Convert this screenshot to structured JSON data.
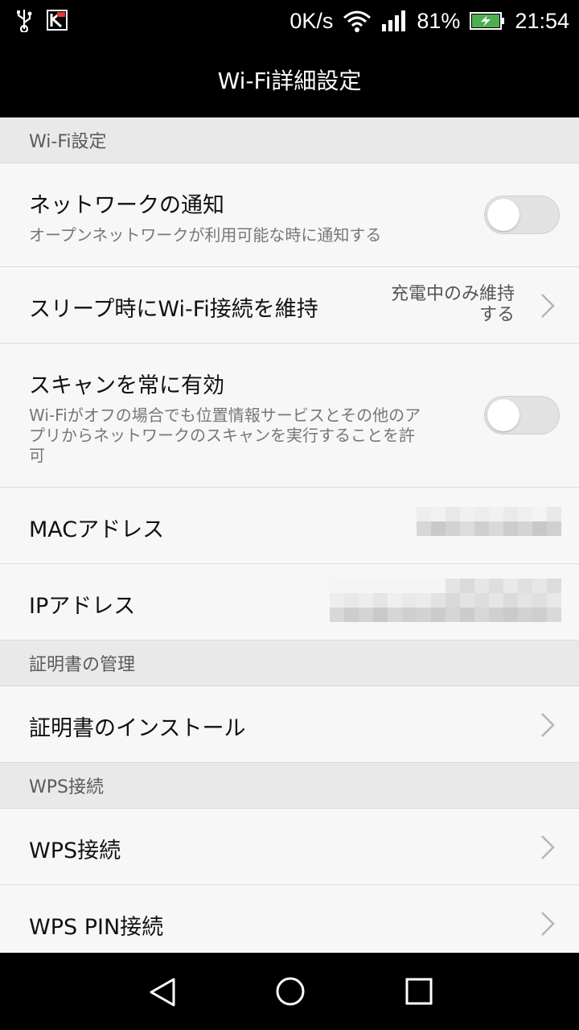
{
  "status_bar": {
    "network_speed": "0K/s",
    "battery_percent": "81%",
    "time": "21:54",
    "icons": [
      "usb-icon",
      "app-notification-icon",
      "wifi-icon",
      "signal-icon",
      "battery-charging-icon"
    ]
  },
  "header": {
    "title": "Wi-Fi詳細設定"
  },
  "sections": {
    "wifi_settings": {
      "header": "Wi-Fi設定",
      "network_notify": {
        "title": "ネットワークの通知",
        "subtitle": "オープンネットワークが利用可能な時に通知する",
        "enabled": false
      },
      "keep_wifi_sleep": {
        "title": "スリープ時にWi-Fi接続を維持",
        "value_line1": "充電中のみ維持",
        "value_line2": "する"
      },
      "always_scan": {
        "title": "スキャンを常に有効",
        "subtitle_line1": "Wi-Fiがオフの場合でも位置情報サービスとその他のア",
        "subtitle_line2": "プリからネットワークのスキャンを実行することを許",
        "subtitle_line3": "可",
        "enabled": false
      },
      "mac_address": {
        "title": "MACアドレス"
      },
      "ip_address": {
        "title": "IPアドレス"
      }
    },
    "certificates": {
      "header": "証明書の管理",
      "install": {
        "title": "証明書のインストール"
      }
    },
    "wps": {
      "header": "WPS接続",
      "wps_connect": {
        "title": "WPS接続"
      },
      "wps_pin_connect": {
        "title": "WPS PIN接続"
      }
    }
  },
  "navigation": {
    "icons": [
      "back-icon",
      "home-icon",
      "recents-icon"
    ]
  },
  "colors": {
    "bar_background": "#000000",
    "content_background": "#f7f7f7",
    "section_header_background": "#e9e9e9",
    "battery_green": "#4caf50"
  }
}
